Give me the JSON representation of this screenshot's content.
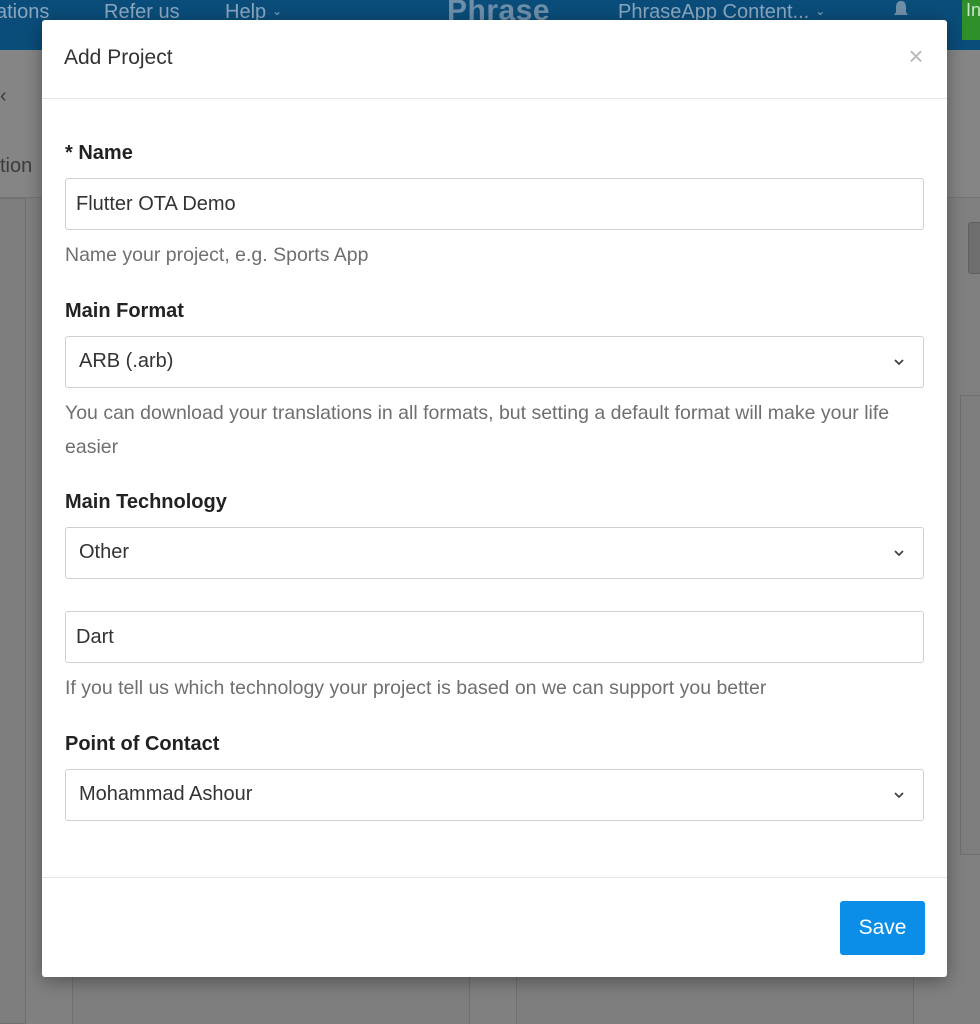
{
  "background": {
    "nav": {
      "items": [
        "ations",
        "Refer us",
        "Help",
        "PhraseApp Content..."
      ],
      "logo": "Phrase",
      "trial_button": "In"
    },
    "side_text": "tion",
    "side_mark": "‹"
  },
  "modal": {
    "title": "Add Project",
    "close_icon": "close-icon",
    "name": {
      "label": "* Name",
      "value": "Flutter OTA Demo",
      "help": "Name your project, e.g. Sports App"
    },
    "main_format": {
      "label": "Main Format",
      "selected": "ARB (.arb)",
      "help": "You can download your translations in all formats, but setting a default format will make your life easier"
    },
    "main_technology": {
      "label": "Main Technology",
      "selected": "Other",
      "other_value": "Dart",
      "help": "If you tell us which technology your project is based on we can support you better"
    },
    "point_of_contact": {
      "label": "Point of Contact",
      "selected": "Mohammad Ashour"
    },
    "footer": {
      "save_label": "Save"
    }
  },
  "colors": {
    "primary": "#0a8ee8",
    "nav_bg": "#0a4d7a"
  }
}
